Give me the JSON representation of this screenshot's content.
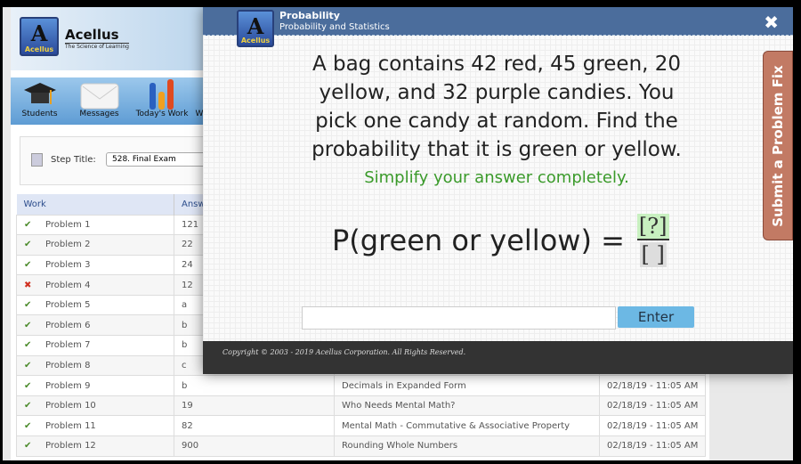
{
  "brand": {
    "logo_text": "Acellus",
    "name": "Acellus",
    "tagline": "The Science of Learning"
  },
  "toolbar": [
    {
      "label": "Students",
      "icon": "graduation-cap-icon"
    },
    {
      "label": "Messages",
      "icon": "envelope-icon"
    },
    {
      "label": "Today's Work",
      "icon": "bar-chart-icon"
    },
    {
      "label": "W",
      "icon": ""
    }
  ],
  "step": {
    "label": "Step Title:",
    "value": "528. Final Exam"
  },
  "table": {
    "headers": [
      "Work",
      "Answ",
      "",
      ""
    ],
    "rows": [
      {
        "status": "correct",
        "work": "Problem 1",
        "answer": "121",
        "title": "",
        "date": ""
      },
      {
        "status": "correct",
        "work": "Problem 2",
        "answer": "22",
        "title": "",
        "date": ""
      },
      {
        "status": "correct",
        "work": "Problem 3",
        "answer": "24",
        "title": "",
        "date": ""
      },
      {
        "status": "incorrect",
        "work": "Problem 4",
        "answer": "12",
        "title": "",
        "date": ""
      },
      {
        "status": "correct",
        "work": "Problem 5",
        "answer": "a",
        "title": "",
        "date": ""
      },
      {
        "status": "correct",
        "work": "Problem 6",
        "answer": "b",
        "title": "",
        "date": ""
      },
      {
        "status": "correct",
        "work": "Problem 7",
        "answer": "b",
        "title": "",
        "date": ""
      },
      {
        "status": "correct",
        "work": "Problem 8",
        "answer": "c",
        "title": "",
        "date": ""
      },
      {
        "status": "correct",
        "work": "Problem 9",
        "answer": "b",
        "title": "Decimals in Expanded Form",
        "date": "02/18/19 - 11:05 AM"
      },
      {
        "status": "correct",
        "work": "Problem 10",
        "answer": "19",
        "title": "Who Needs Mental Math?",
        "date": "02/18/19 - 11:05 AM"
      },
      {
        "status": "correct",
        "work": "Problem 11",
        "answer": "82",
        "title": "Mental Math - Commutative & Associative Property",
        "date": "02/18/19 - 11:05 AM"
      },
      {
        "status": "correct",
        "work": "Problem 12",
        "answer": "900",
        "title": "Rounding Whole Numbers",
        "date": "02/18/19 - 11:05 AM"
      }
    ]
  },
  "modal": {
    "title": "Probability",
    "subtitle": "Probability and Statistics",
    "close": "✖",
    "question": "A bag contains 42 red, 45 green, 20 yellow, and 32 purple candies. You pick one candy at random. Find the probability that it is green or yellow.",
    "instruction": "Simplify your answer completely.",
    "expression": "P(green or yellow) =",
    "numerator": "[?]",
    "denominator": "[ ]",
    "answer_value": "",
    "enter_label": "Enter",
    "copyright": "Copyright © 2003 - 2019 Acellus Corporation.  All Rights Reserved.",
    "side_tab": "Submit a Problem Fix"
  },
  "colors": {
    "modal_header": "#4b6d9c",
    "correct": "#4a8a2a",
    "incorrect": "#d03020",
    "instruction": "#3a9a2a",
    "enter": "#6cb8e4",
    "side_tab": "#c27a64"
  }
}
